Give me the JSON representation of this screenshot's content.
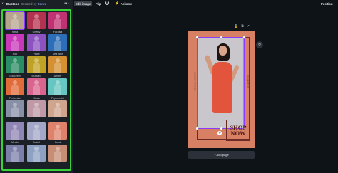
{
  "panel": {
    "back_icon": "‹",
    "title": "Duotone",
    "credit_prefix": "Created by",
    "credit_author": "Canva",
    "more_icon": "•••"
  },
  "filters": [
    {
      "label": "Nelia",
      "color": "#b7a48f",
      "selected": true
    },
    {
      "label": "Cherry",
      "color": "#b4324f"
    },
    {
      "label": "Fuchsia",
      "color": "#c03273"
    },
    {
      "label": "Pop",
      "color": "#c838b8"
    },
    {
      "label": "Violet",
      "color": "#8b52c0"
    },
    {
      "label": "Sea Blue",
      "color": "#2c6fb8"
    },
    {
      "label": "Sea Green",
      "color": "#2a8d63"
    },
    {
      "label": "Mustard",
      "color": "#c0a324"
    },
    {
      "label": "Amber",
      "color": "#d59032"
    },
    {
      "label": "Periwinkle",
      "color": "#e26b3a"
    },
    {
      "label": "Blush",
      "color": "#d9658e"
    },
    {
      "label": "Peppermint",
      "color": "#66c6c1"
    },
    {
      "label": "",
      "color": "#8890a8"
    },
    {
      "label": "",
      "color": "#bf9aa6"
    },
    {
      "label": "",
      "color": "#d0a58e"
    },
    {
      "label": "Mystic",
      "color": "#8f86b5"
    },
    {
      "label": "Pastel",
      "color": "#a4a7c7"
    },
    {
      "label": "Coral",
      "color": "#df826b"
    },
    {
      "label": "",
      "color": "#7c7fa9"
    },
    {
      "label": "",
      "color": "#8fa1c2"
    },
    {
      "label": "",
      "color": "#c78e75"
    }
  ],
  "toolbar": {
    "edit_image": "Edit image",
    "flip": "Flip",
    "info_icon": "i",
    "animate_icon": "⚡",
    "animate": "Animate",
    "position": "Position"
  },
  "canvas": {
    "page_icons": [
      "🔒",
      "⧉",
      "↗"
    ],
    "rotate_icon": "↻",
    "side_text_left": "SUMMER FASHION",
    "side_text_right": "COLLECTION",
    "shop_text": "SHOP NOW",
    "add_page": "+ Add page",
    "refresh_icon": "↻"
  },
  "colors": {
    "accent_green": "#3ad13a",
    "selection": "#8b3dff",
    "artboard": "#d78064"
  }
}
